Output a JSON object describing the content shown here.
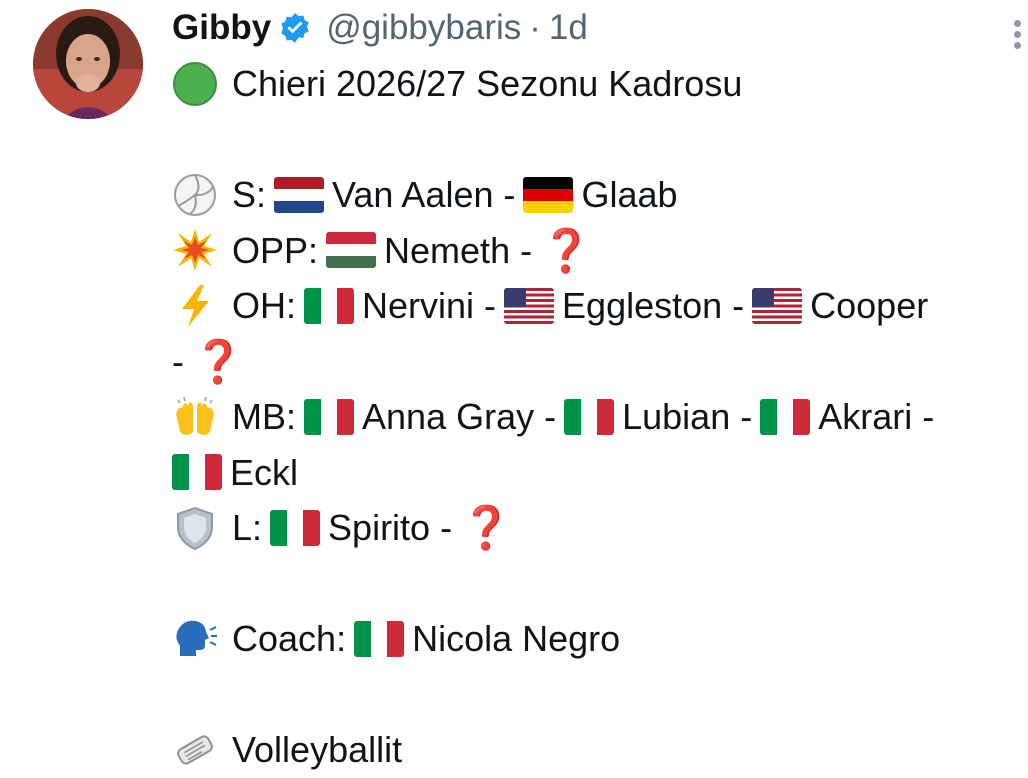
{
  "author": {
    "name": "Gibby",
    "handle": "@gibbybaris",
    "separator": "·",
    "time": "1d"
  },
  "tweet": {
    "title": "Chieri 2026/27 Sezonu Kadrosu",
    "lines": {
      "setter_label": "S:",
      "setter_1": "Van Aalen -",
      "setter_2": "Glaab",
      "opp_label": "OPP:",
      "opp_1": "Nemeth -",
      "oh_label": "OH:",
      "oh_1": "Nervini -",
      "oh_2": "Eggleston -",
      "oh_3": "Cooper",
      "oh_cont": "-",
      "mb_label": "MB:",
      "mb_1": "Anna Gray -",
      "mb_2": "Lubian -",
      "mb_3": "Akrari -",
      "mb_4": "Eckl",
      "libero_label": "L:",
      "libero_1": "Spirito -",
      "coach_label": "Coach:",
      "coach_1": "Nicola Negro",
      "source": "Volleyballit"
    },
    "question_mark": "❓"
  },
  "icons": {
    "status": "green-circle-icon",
    "setter": "volleyball-icon",
    "opposite": "collision-icon",
    "outside": "lightning-icon",
    "middle": "raised-hands-icon",
    "libero": "shield-icon",
    "coach": "speaking-head-icon",
    "source": "newspaper-icon"
  },
  "colors": {
    "text": "#0f1419",
    "muted": "#536471",
    "verified": "#1d9bf0",
    "question": "#d92b2b"
  }
}
